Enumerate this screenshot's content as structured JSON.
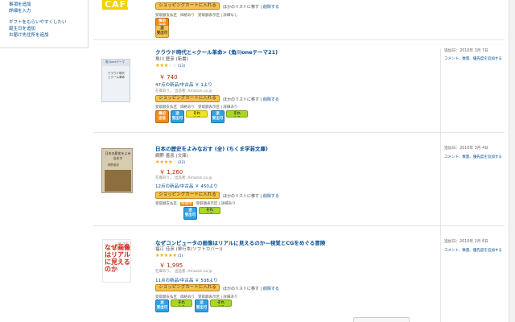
{
  "sidebar": {
    "links": [
      "事項を追加",
      "詳細を入力",
      "ギフトをもらいやすくしたい",
      "誕生日を追加",
      "お届け先住所を追加"
    ]
  },
  "items": [
    {
      "cart_button": "ショッピングカートに入れる",
      "wish_label": "ほかのリストに移す",
      "wish_delete": "削除する",
      "labels": [
        "受取額支払区",
        "価格あり",
        "受取額表示区 | 詳細なし"
      ],
      "tags": [
        {
          "label": "事前\n送信",
          "color": "#ef8a1d"
        },
        {
          "label": "送\n受出可",
          "color": "#f6c24d"
        }
      ]
    },
    {
      "title": "クラウド時代と<クール革命> (角川oneテーマ21)",
      "author": "角川 歴彦 (新書)",
      "rating_count": "(13)",
      "rating": 3,
      "price": "￥ 740",
      "offers": "47点の新品/中古品 ￥ 1より",
      "shipping": "在庫あり。 出品者: Amazon.co.jp",
      "cart_button": "ショッピングカートに入れる",
      "wish_label": "ほかのリストに移す",
      "wish_delete": "削除する",
      "labels": [
        "受取額支払区",
        "価格あり",
        "受取額表示区 | 詳細あり"
      ],
      "tags": [
        {
          "label": "最初\n送信",
          "color": "#ef8a1d"
        },
        {
          "label": "送\n受出可",
          "color": "#2fa1e6"
        },
        {
          "label": "それ\nめる",
          "color": "#f2e31f"
        },
        {
          "label": "送\n受出可",
          "color": "#2fa1e6"
        },
        {
          "label": "それ\nめる",
          "color": "#a8d91f"
        }
      ],
      "date": "追加日：2010年 3月 7日",
      "actions": "コメント、数量、優先度を追加する"
    },
    {
      "title": "日本の歴史をよみなおす (全) (ちくま学芸文庫)",
      "author": "網野 善彦 (文庫)",
      "rating_count": "(22)",
      "rating": 4,
      "price": "￥ 1,260",
      "offers": "12点の新品/中古品 ￥ 450より",
      "shipping": "在庫あり。 出品者: Amazon.co.jp",
      "cart_button": "ショッピングカートに入れる",
      "wish_label": "ほかのリストに移す",
      "wish_delete": "削除する",
      "labels": [
        "受取額支払区",
        "特価中",
        "受取額表示区 | 詳細あり"
      ],
      "tags": [
        {
          "label": "送\n受出可",
          "color": "#2fa1e6"
        },
        {
          "label": "それ\nめる",
          "color": "#a8d91f"
        }
      ],
      "date": "追加日：2010年 3月 4日",
      "actions": "コメント、数量、優先度を追加する"
    },
    {
      "title": "なぜコンピュータの画像はリアルに見えるのか—視覚とCGをめぐる冒険",
      "author": "福江 佳彦 (単行本(ソフトカバー))",
      "rating_count": "(1)",
      "rating": 5,
      "price": "￥ 1,995",
      "offers": "11点の新品/中古品 ￥ 538より",
      "shipping": "在庫あり。 出品者: Amazon.co.jp",
      "cart_button": "ショッピングカートに入れる",
      "wish_label": "ほかのリストに移す",
      "wish_delete": "削除する",
      "labels": [
        "受取額支払区",
        "価格あり",
        "受取額表示区 | 詳細あり"
      ],
      "tags": [
        {
          "label": "送\n受出可",
          "color": "#2fa1e6"
        },
        {
          "label": "それ\nめる",
          "color": "#a8d91f"
        },
        {
          "label": "送\n受出可",
          "color": "#2fa1e6"
        },
        {
          "label": "それ\nめる",
          "color": "#a8d91f"
        }
      ],
      "date": "追加日：2010年 2月 8日",
      "actions": "コメント、数量、優先度を追加する"
    }
  ],
  "covers": {
    "item0": "CAFE",
    "item1_band": "角川oneテーマ",
    "item1_title": "クラウド時代とクール革命",
    "item2_title": "日本の歴史をよみなおす",
    "item2_author": "網野善彦",
    "item3_title": "なぜ画像はリアルに見えるのか",
    "item3_pre": "福江佳彦",
    "item3_sub": "コンピュータの"
  }
}
